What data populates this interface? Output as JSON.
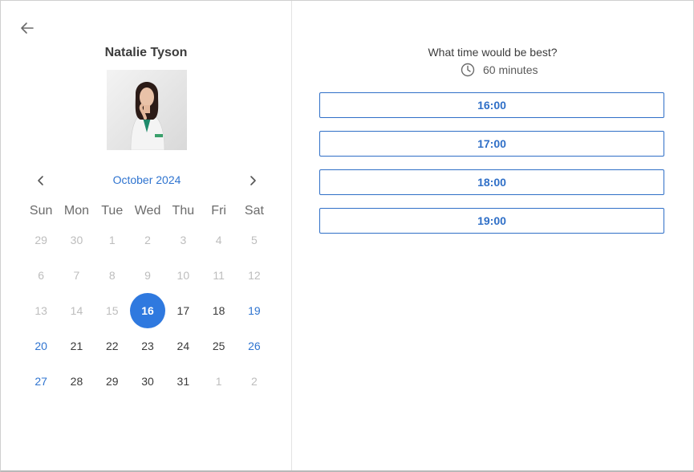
{
  "profile": {
    "name": "Natalie Tyson"
  },
  "calendar": {
    "month_label": "October 2024",
    "weekdays": [
      "Sun",
      "Mon",
      "Tue",
      "Wed",
      "Thu",
      "Fri",
      "Sat"
    ],
    "days": [
      {
        "label": "29",
        "state": "muted"
      },
      {
        "label": "30",
        "state": "muted"
      },
      {
        "label": "1",
        "state": "muted"
      },
      {
        "label": "2",
        "state": "muted"
      },
      {
        "label": "3",
        "state": "muted"
      },
      {
        "label": "4",
        "state": "muted"
      },
      {
        "label": "5",
        "state": "muted"
      },
      {
        "label": "6",
        "state": "muted"
      },
      {
        "label": "7",
        "state": "muted"
      },
      {
        "label": "8",
        "state": "muted"
      },
      {
        "label": "9",
        "state": "muted"
      },
      {
        "label": "10",
        "state": "muted"
      },
      {
        "label": "11",
        "state": "muted"
      },
      {
        "label": "12",
        "state": "muted"
      },
      {
        "label": "13",
        "state": "muted"
      },
      {
        "label": "14",
        "state": "muted"
      },
      {
        "label": "15",
        "state": "muted"
      },
      {
        "label": "16",
        "state": "selected"
      },
      {
        "label": "17",
        "state": "normal"
      },
      {
        "label": "18",
        "state": "normal"
      },
      {
        "label": "19",
        "state": "weekend"
      },
      {
        "label": "20",
        "state": "weekend"
      },
      {
        "label": "21",
        "state": "normal"
      },
      {
        "label": "22",
        "state": "normal"
      },
      {
        "label": "23",
        "state": "normal"
      },
      {
        "label": "24",
        "state": "normal"
      },
      {
        "label": "25",
        "state": "normal"
      },
      {
        "label": "26",
        "state": "weekend"
      },
      {
        "label": "27",
        "state": "weekend"
      },
      {
        "label": "28",
        "state": "normal"
      },
      {
        "label": "29",
        "state": "normal"
      },
      {
        "label": "30",
        "state": "normal"
      },
      {
        "label": "31",
        "state": "normal"
      },
      {
        "label": "1",
        "state": "muted"
      },
      {
        "label": "2",
        "state": "muted"
      }
    ]
  },
  "scheduler": {
    "question": "What time would be best?",
    "duration": "60 minutes",
    "slots": [
      "16:00",
      "17:00",
      "18:00",
      "19:00"
    ]
  },
  "icons": {
    "back": "arrow-left-icon",
    "prev": "chevron-left-icon",
    "next": "chevron-right-icon",
    "clock": "clock-icon"
  },
  "colors": {
    "accent": "#2f74d0",
    "selected_day_bg": "#2f79df",
    "slot_border": "#2f6fc7"
  }
}
